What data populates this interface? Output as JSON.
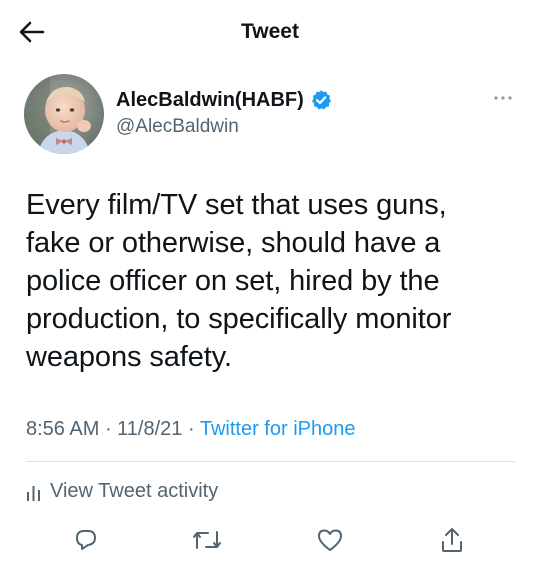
{
  "header": {
    "title": "Tweet",
    "back_icon": "arrow-left-icon"
  },
  "author": {
    "display_name": "AlecBaldwin(HABF)",
    "handle": "@AlecBaldwin",
    "verified": true,
    "verified_color": "#1d9bf0"
  },
  "tweet": {
    "text": "Every film/TV set that uses guns,\nfake or otherwise, should have a\npolice officer on set, hired by the\nproduction, to specifically monitor\nweapons safety.",
    "time": "8:56 AM",
    "separator1": " · ",
    "date": "11/8/21",
    "separator2": " · ",
    "source": "Twitter for iPhone"
  },
  "activity": {
    "label": "View Tweet activity",
    "icon": "bar-chart-icon"
  },
  "actions": [
    {
      "name": "reply",
      "icon": "reply-icon"
    },
    {
      "name": "retweet",
      "icon": "retweet-icon"
    },
    {
      "name": "like",
      "icon": "heart-icon"
    },
    {
      "name": "share",
      "icon": "share-icon"
    }
  ],
  "colors": {
    "accent": "#1d9bf0",
    "text": "#0f1419",
    "secondary": "#536471",
    "divider": "#dfe3e6"
  }
}
